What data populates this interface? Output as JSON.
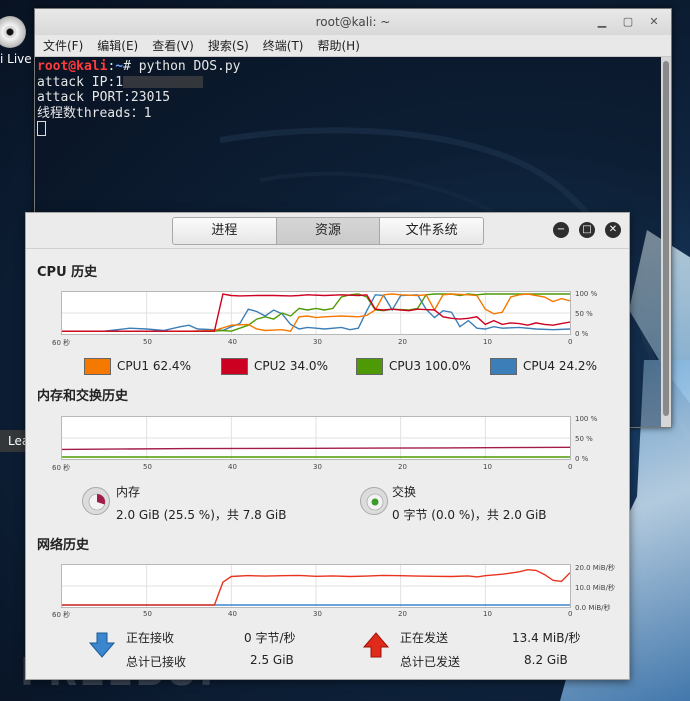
{
  "desktop": {
    "icon_label": "i Live",
    "leafpad_label": "Leafpad",
    "watermark": "FREEBUF"
  },
  "terminal": {
    "title": "root@kali: ~",
    "menu": [
      "文件(F)",
      "编辑(E)",
      "查看(V)",
      "搜索(S)",
      "终端(T)",
      "帮助(H)"
    ],
    "prompt_user": "root@kali",
    "prompt_sep": ":",
    "prompt_path": "~",
    "command": "# python DOS.py",
    "line_ip": "attack IP:1",
    "line_port": "attack PORT:23015",
    "line_threads": "线程数threads：1"
  },
  "sysmon": {
    "tabs": [
      "进程",
      "资源",
      "文件系统"
    ],
    "active_tab": "资源",
    "cpu": {
      "title": "CPU 历史",
      "legend": [
        {
          "label": "CPU1 62.4%",
          "color": "#f57900"
        },
        {
          "label": "CPU2 34.0%",
          "color": "#cc0020"
        },
        {
          "label": "CPU3 100.0%",
          "color": "#4e9a06"
        },
        {
          "label": "CPU4 24.2%",
          "color": "#3c7fb8"
        }
      ]
    },
    "mem": {
      "title": "内存和交换历史",
      "mem_label": "内存",
      "mem_value": "2.0 GiB (25.5 %)，共 7.8 GiB",
      "swap_label": "交换",
      "swap_value": "0 字节 (0.0 %)，共 2.0 GiB"
    },
    "net": {
      "title": "网络历史",
      "recv_label": "正在接收",
      "recv_value": "0 字节/秒",
      "total_recv_label": "总计已接收",
      "total_recv_value": "2.5 GiB",
      "send_label": "正在发送",
      "send_value": "13.4 MiB/秒",
      "total_send_label": "总计已发送",
      "total_send_value": "8.2 GiB"
    },
    "axes": {
      "x_ticks": [
        "60 秒",
        "50",
        "40",
        "30",
        "20",
        "10",
        "0"
      ],
      "percent_ticks": [
        "100 %",
        "50 %",
        "0 %"
      ],
      "net_ticks": [
        "20.0 MiB/秒",
        "10.0 MiB/秒",
        "0.0 MiB/秒"
      ]
    },
    "series": {
      "cpu1": [
        [
          60,
          2
        ],
        [
          45,
          2
        ],
        [
          42,
          4
        ],
        [
          40,
          18
        ],
        [
          38,
          20
        ],
        [
          37,
          8
        ],
        [
          36,
          4
        ],
        [
          34,
          6
        ],
        [
          33,
          2
        ],
        [
          32,
          40
        ],
        [
          31,
          42
        ],
        [
          30,
          38
        ],
        [
          29,
          40
        ],
        [
          27,
          42
        ],
        [
          25,
          40
        ],
        [
          24,
          44
        ],
        [
          23,
          58
        ],
        [
          22,
          98
        ],
        [
          21,
          100
        ],
        [
          20,
          98
        ],
        [
          18,
          96
        ],
        [
          17,
          98
        ],
        [
          16,
          58
        ],
        [
          15,
          98
        ],
        [
          14,
          100
        ],
        [
          12,
          98
        ],
        [
          11,
          96
        ],
        [
          10,
          60
        ],
        [
          9,
          48
        ],
        [
          8,
          52
        ],
        [
          7,
          92
        ],
        [
          6,
          98
        ],
        [
          5,
          100
        ],
        [
          4,
          96
        ],
        [
          3,
          92
        ],
        [
          2,
          80
        ],
        [
          1,
          88
        ],
        [
          0,
          82
        ]
      ],
      "cpu2": [
        [
          60,
          2
        ],
        [
          42,
          2
        ],
        [
          41,
          100
        ],
        [
          40,
          96
        ],
        [
          39,
          95
        ],
        [
          37,
          96
        ],
        [
          35,
          96
        ],
        [
          33,
          95
        ],
        [
          32,
          96
        ],
        [
          31,
          98
        ],
        [
          29,
          96
        ],
        [
          27,
          98
        ],
        [
          25,
          96
        ],
        [
          24,
          98
        ],
        [
          23,
          60
        ],
        [
          22,
          58
        ],
        [
          21,
          60
        ],
        [
          20,
          58
        ],
        [
          19,
          56
        ],
        [
          18,
          60
        ],
        [
          16,
          58
        ],
        [
          15,
          40
        ],
        [
          14,
          36
        ],
        [
          13,
          34
        ],
        [
          12,
          36
        ],
        [
          11,
          40
        ],
        [
          10,
          20
        ],
        [
          9,
          30
        ],
        [
          8,
          20
        ],
        [
          7,
          24
        ],
        [
          6,
          22
        ],
        [
          5,
          18
        ],
        [
          4,
          24
        ],
        [
          3,
          20
        ],
        [
          2,
          18
        ],
        [
          1,
          22
        ],
        [
          0,
          26
        ]
      ],
      "cpu3": [
        [
          60,
          2
        ],
        [
          42,
          2
        ],
        [
          41,
          4
        ],
        [
          40,
          2
        ],
        [
          39,
          10
        ],
        [
          38,
          18
        ],
        [
          37,
          34
        ],
        [
          36,
          40
        ],
        [
          35,
          34
        ],
        [
          34,
          50
        ],
        [
          33,
          42
        ],
        [
          32,
          62
        ],
        [
          31,
          58
        ],
        [
          30,
          62
        ],
        [
          29,
          58
        ],
        [
          28,
          62
        ],
        [
          27,
          92
        ],
        [
          26,
          98
        ],
        [
          25,
          100
        ],
        [
          24,
          92
        ],
        [
          23,
          58
        ],
        [
          22,
          56
        ],
        [
          21,
          60
        ],
        [
          19,
          58
        ],
        [
          18,
          62
        ],
        [
          17,
          98
        ],
        [
          16,
          100
        ],
        [
          14,
          100
        ],
        [
          13,
          96
        ],
        [
          12,
          100
        ],
        [
          11,
          98
        ],
        [
          10,
          100
        ],
        [
          8,
          100
        ],
        [
          6,
          100
        ],
        [
          4,
          100
        ],
        [
          2,
          100
        ],
        [
          0,
          100
        ]
      ],
      "cpu4": [
        [
          60,
          2
        ],
        [
          55,
          2
        ],
        [
          52,
          10
        ],
        [
          50,
          8
        ],
        [
          48,
          4
        ],
        [
          46,
          14
        ],
        [
          45,
          18
        ],
        [
          44,
          8
        ],
        [
          42,
          6
        ],
        [
          41,
          4
        ],
        [
          40,
          14
        ],
        [
          39,
          22
        ],
        [
          38,
          60
        ],
        [
          37,
          54
        ],
        [
          36,
          42
        ],
        [
          35,
          58
        ],
        [
          34,
          48
        ],
        [
          33,
          20
        ],
        [
          32,
          8
        ],
        [
          31,
          12
        ],
        [
          30,
          10
        ],
        [
          29,
          8
        ],
        [
          27,
          12
        ],
        [
          26,
          6
        ],
        [
          25,
          10
        ],
        [
          24,
          56
        ],
        [
          23,
          98
        ],
        [
          22,
          96
        ],
        [
          21,
          58
        ],
        [
          20,
          96
        ],
        [
          18,
          98
        ],
        [
          17,
          60
        ],
        [
          16,
          38
        ],
        [
          15,
          56
        ],
        [
          14,
          52
        ],
        [
          13,
          14
        ],
        [
          12,
          30
        ],
        [
          11,
          10
        ],
        [
          10,
          8
        ],
        [
          9,
          14
        ],
        [
          8,
          10
        ],
        [
          6,
          12
        ],
        [
          4,
          8
        ],
        [
          2,
          6
        ],
        [
          0,
          8
        ]
      ],
      "mem": [
        [
          60,
          20
        ],
        [
          45,
          22
        ],
        [
          30,
          23
        ],
        [
          15,
          24
        ],
        [
          0,
          25.5
        ]
      ],
      "swap": [
        [
          60,
          0
        ],
        [
          0,
          0
        ]
      ],
      "net_send": [
        [
          60,
          0
        ],
        [
          42,
          0
        ],
        [
          41,
          12
        ],
        [
          40,
          15
        ],
        [
          38,
          15.5
        ],
        [
          36,
          15.2
        ],
        [
          34,
          15.4
        ],
        [
          32,
          15.6
        ],
        [
          30,
          15.1
        ],
        [
          28,
          15.3
        ],
        [
          26,
          15.0
        ],
        [
          24,
          15.2
        ],
        [
          22,
          15.6
        ],
        [
          20,
          15.4
        ],
        [
          18,
          15.2
        ],
        [
          16,
          15.1
        ],
        [
          14,
          15.0
        ],
        [
          12,
          15.3
        ],
        [
          11,
          14.8
        ],
        [
          10,
          15.4
        ],
        [
          8,
          16.2
        ],
        [
          7,
          16.8
        ],
        [
          6,
          17.5
        ],
        [
          5,
          18.6
        ],
        [
          4,
          18.2
        ],
        [
          3,
          16.0
        ],
        [
          2,
          13.0
        ],
        [
          1,
          12.4
        ],
        [
          0,
          17.0
        ]
      ],
      "net_recv": [
        [
          60,
          0
        ],
        [
          0,
          0
        ]
      ]
    }
  }
}
